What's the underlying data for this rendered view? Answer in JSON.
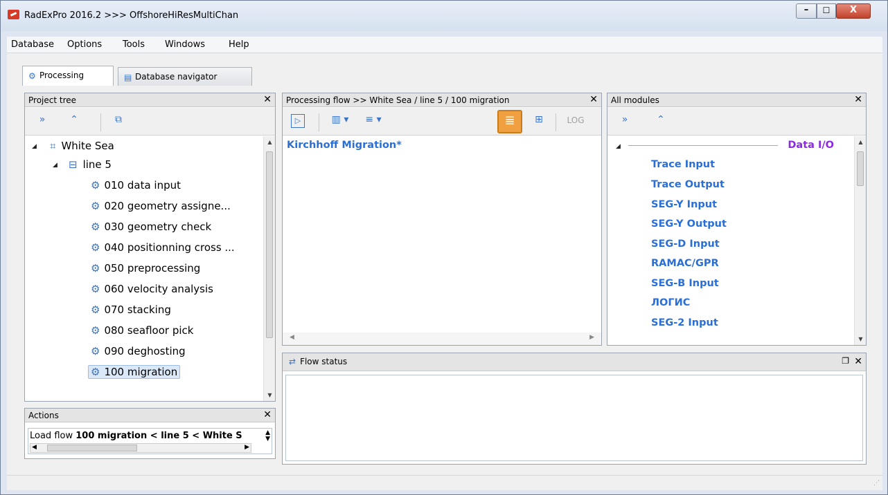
{
  "window": {
    "title": "RadExPro 2016.2 >>> OffshoreHiResMultiChan"
  },
  "menu": [
    "Database",
    "Options",
    "Tools",
    "Windows",
    "Help"
  ],
  "tabs": [
    {
      "label": "Processing",
      "icon": "gear-icon"
    },
    {
      "label": "Database navigator",
      "icon": "database-search-icon"
    }
  ],
  "project_tree": {
    "title": "Project tree",
    "root": "White Sea",
    "line": "line 5",
    "flows": [
      "010 data input",
      "020 geometry assigne...",
      "030 geometry check",
      "040 positionning cross ...",
      "050 preprocessing",
      "060 velocity analysis",
      "070 stacking",
      "080 seafloor pick",
      "090 deghosting",
      "100 migration"
    ],
    "selected": "100 migration"
  },
  "actions": {
    "title": "Actions",
    "prefix": "Load flow ",
    "bold": "100 migration < line 5 < White S"
  },
  "processing_flow": {
    "title": "Processing flow >> White Sea / line 5 / 100 migration",
    "items": [
      "Kirchhoff Migration*"
    ],
    "log_label": "LOG"
  },
  "all_modules": {
    "title": "All modules",
    "category": "Data I/O",
    "items": [
      "Trace Input",
      "Trace Output",
      "SEG-Y Input",
      "SEG-Y Output",
      "SEG-D Input",
      "RAMAC/GPR",
      "SEG-B Input",
      "ЛОГИС",
      "SEG-2 Input"
    ]
  },
  "flow_status": {
    "title": "Flow status"
  },
  "colors": {
    "link": "#2a6fd6",
    "category": "#8a2be2",
    "active_button": "#f0a040"
  }
}
